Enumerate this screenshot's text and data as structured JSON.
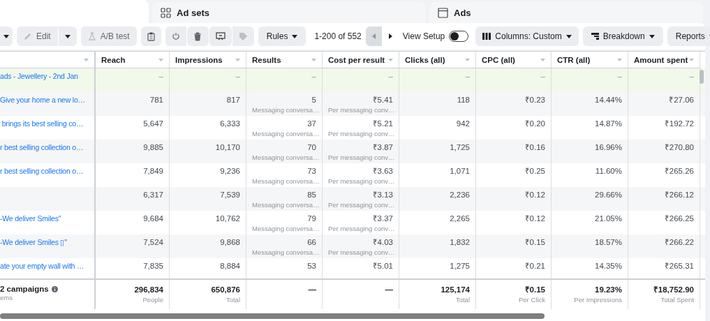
{
  "tabs": [
    {
      "label": "Ad sets"
    },
    {
      "label": "Ads"
    }
  ],
  "toolbar": {
    "edit": {
      "label": "Edit",
      "disabled": true
    },
    "ab_test": {
      "label": "A/B test",
      "disabled": true
    },
    "rules": "Rules",
    "range": "1-200 of 552",
    "view_setup": {
      "label": "View Setup",
      "on": false
    },
    "columns": "Columns: Custom",
    "breakdown": "Breakdown",
    "reports": "Reports"
  },
  "table": {
    "columns": [
      "Reach",
      "Impressions",
      "Results",
      "Cost per result",
      "Clicks (all)",
      "CPC (all)",
      "CTR (all)",
      "Amount spent"
    ],
    "rows": [
      {
        "kind": "campaign",
        "name": "ads - Jewellery - 2nd Jan",
        "cells": [
          {
            "value": "–"
          },
          {
            "value": "–"
          },
          {
            "value": "–"
          },
          {
            "value": "–"
          },
          {
            "value": "–"
          },
          {
            "value": "–"
          },
          {
            "value": "–"
          },
          {
            "value": "–"
          }
        ]
      },
      {
        "kind": "ad",
        "name": "Give your home a new lo…",
        "cells": [
          {
            "value": "781"
          },
          {
            "value": "817"
          },
          {
            "value": "5",
            "sub": "Messaging conversa…"
          },
          {
            "value": "₹5.41",
            "sub": "Per messaging conv…"
          },
          {
            "value": "118"
          },
          {
            "value": "₹0.23"
          },
          {
            "value": "14.44%"
          },
          {
            "value": "₹27.06"
          }
        ]
      },
      {
        "kind": "ad",
        "name": " brings its best selling co…",
        "cells": [
          {
            "value": "5,647"
          },
          {
            "value": "6,333"
          },
          {
            "value": "37",
            "sub": "Messaging conversa…"
          },
          {
            "value": "₹5.21",
            "sub": "Per messaging conv…"
          },
          {
            "value": "942"
          },
          {
            "value": "₹0.20"
          },
          {
            "value": "14.87%"
          },
          {
            "value": "₹192.72"
          }
        ]
      },
      {
        "kind": "ad",
        "name": "r best selling collection o…",
        "cells": [
          {
            "value": "9,885"
          },
          {
            "value": "10,170"
          },
          {
            "value": "70",
            "sub": "Messaging conversa…"
          },
          {
            "value": "₹3.87",
            "sub": "Per messaging conv…"
          },
          {
            "value": "1,725"
          },
          {
            "value": "₹0.16"
          },
          {
            "value": "16.96%"
          },
          {
            "value": "₹270.80"
          }
        ]
      },
      {
        "kind": "ad",
        "name": "r best selling collection o…",
        "cells": [
          {
            "value": "7,849"
          },
          {
            "value": "9,236"
          },
          {
            "value": "73",
            "sub": "Messaging conversa…"
          },
          {
            "value": "₹3.63",
            "sub": "Per messaging conv…"
          },
          {
            "value": "1,071"
          },
          {
            "value": "₹0.25"
          },
          {
            "value": "11.60%"
          },
          {
            "value": "₹265.26"
          }
        ]
      },
      {
        "kind": "ad",
        "cells": [
          {
            "value": "6,317"
          },
          {
            "value": "7,539"
          },
          {
            "value": "85",
            "sub": "Messaging conversa…"
          },
          {
            "value": "₹3.13",
            "sub": "Per messaging conv…"
          },
          {
            "value": "2,236"
          },
          {
            "value": "₹0.12"
          },
          {
            "value": "29.66%"
          },
          {
            "value": "₹266.12"
          }
        ]
      },
      {
        "kind": "ad",
        "name": "-We deliver Smiles\"",
        "cells": [
          {
            "value": "9,684"
          },
          {
            "value": "10,762"
          },
          {
            "value": "79",
            "sub": "Messaging conversa…"
          },
          {
            "value": "₹3.37",
            "sub": "Per messaging conv…"
          },
          {
            "value": "2,265"
          },
          {
            "value": "₹0.12"
          },
          {
            "value": "21.05%"
          },
          {
            "value": "₹266.25"
          }
        ]
      },
      {
        "kind": "ad",
        "name": "-We deliver Smiles ▯\"",
        "cells": [
          {
            "value": "7,524"
          },
          {
            "value": "9,868"
          },
          {
            "value": "66",
            "sub": "Messaging conversa…"
          },
          {
            "value": "₹4.03",
            "sub": "Per messaging conv…"
          },
          {
            "value": "1,832"
          },
          {
            "value": "₹0.15"
          },
          {
            "value": "18.57%"
          },
          {
            "value": "₹266.22"
          }
        ]
      },
      {
        "kind": "ad",
        "name": "ate your empty wall with …",
        "cells": [
          {
            "value": "7,835"
          },
          {
            "value": "8,884"
          },
          {
            "value": "53"
          },
          {
            "value": "₹5.01"
          },
          {
            "value": "1,275"
          },
          {
            "value": "₹0.21"
          },
          {
            "value": "14.35%"
          },
          {
            "value": "₹265.31"
          }
        ]
      }
    ],
    "totals": {
      "name": "2 campaigns",
      "sub": "ems",
      "cells": [
        {
          "value": "296,834",
          "sub": "People"
        },
        {
          "value": "650,876",
          "sub": "Total"
        },
        {
          "value": "—"
        },
        {
          "value": "—"
        },
        {
          "value": "125,174",
          "sub": "Total"
        },
        {
          "value": "₹0.15",
          "sub": "Per Click"
        },
        {
          "value": "19.23%",
          "sub": "Per Impressions"
        },
        {
          "value": "₹18,752.90",
          "sub": "Total Spent"
        }
      ]
    }
  }
}
